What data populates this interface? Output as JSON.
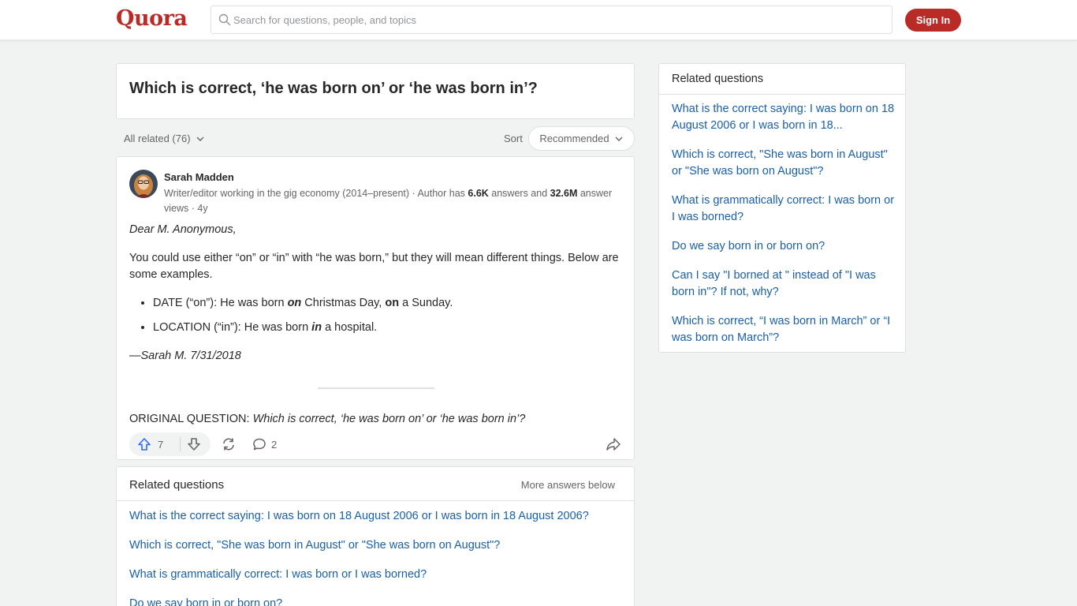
{
  "header": {
    "logo": "Quora",
    "search_placeholder": "Search for questions, people, and topics",
    "signin_label": "Sign In",
    "brand_color": "#b92b27"
  },
  "question": {
    "title": "Which is correct, ‘he was born on’ or ‘he was born in’?"
  },
  "filters": {
    "all_related": "All related (76)",
    "sort_label": "Sort",
    "sort_value": "Recommended"
  },
  "answer": {
    "author_name": "Sarah Madden",
    "cred_prefix": "Writer/editor working in the gig economy (2014–present) · Author has ",
    "answers_count": "6.6K",
    "cred_middle": " answers and ",
    "views_count": "32.6M",
    "cred_suffix": " answer views · 4y",
    "greeting": "Dear M. Anonymous,",
    "intro": "You could use either “on” or “in” with “he was born,” but they will mean different things. Below are some examples.",
    "bullet1_prefix": "DATE (“on”): He was born ",
    "bullet1_em1": "on",
    "bullet1_middle": " Christmas Day, ",
    "bullet1_bold": "on",
    "bullet1_suffix": " a Sunday.",
    "bullet2_prefix": "LOCATION (“in”): He was born ",
    "bullet2_em": "in",
    "bullet2_suffix": " a hospital.",
    "signature": "—Sarah M. 7/31/2018",
    "original_label": "ORIGINAL QUESTION: ",
    "original_text": "Which is correct, ‘he was born on’ or ‘he was born in’?",
    "upvotes": "7",
    "comments": "2"
  },
  "related_bottom": {
    "title": "Related questions",
    "more": "More answers below",
    "items": [
      "What is the correct saying: I was born on 18 August 2006 or I was born in 18 August 2006?",
      "Which is correct, \"She was born in August\" or \"She was born on August\"?",
      "What is grammatically correct: I was born or I was borned?",
      "Do we say born in or born on?"
    ]
  },
  "related_side": {
    "title": "Related questions",
    "items": [
      "What is the correct saying: I was born on 18 August 2006 or I was born in 18...",
      "Which is correct, \"She was born in August\" or \"She was born on August\"?",
      "What is grammatically correct: I was born or I was borned?",
      "Do we say born in or born on?",
      "Can I say \"I borned at \" instead of \"I was born in\"? If not, why?",
      "Which is correct, “I was born in March” or “I was born on March”?"
    ]
  },
  "colors": {
    "link": "#195faa",
    "upvote_icon": "#2e69ff"
  }
}
